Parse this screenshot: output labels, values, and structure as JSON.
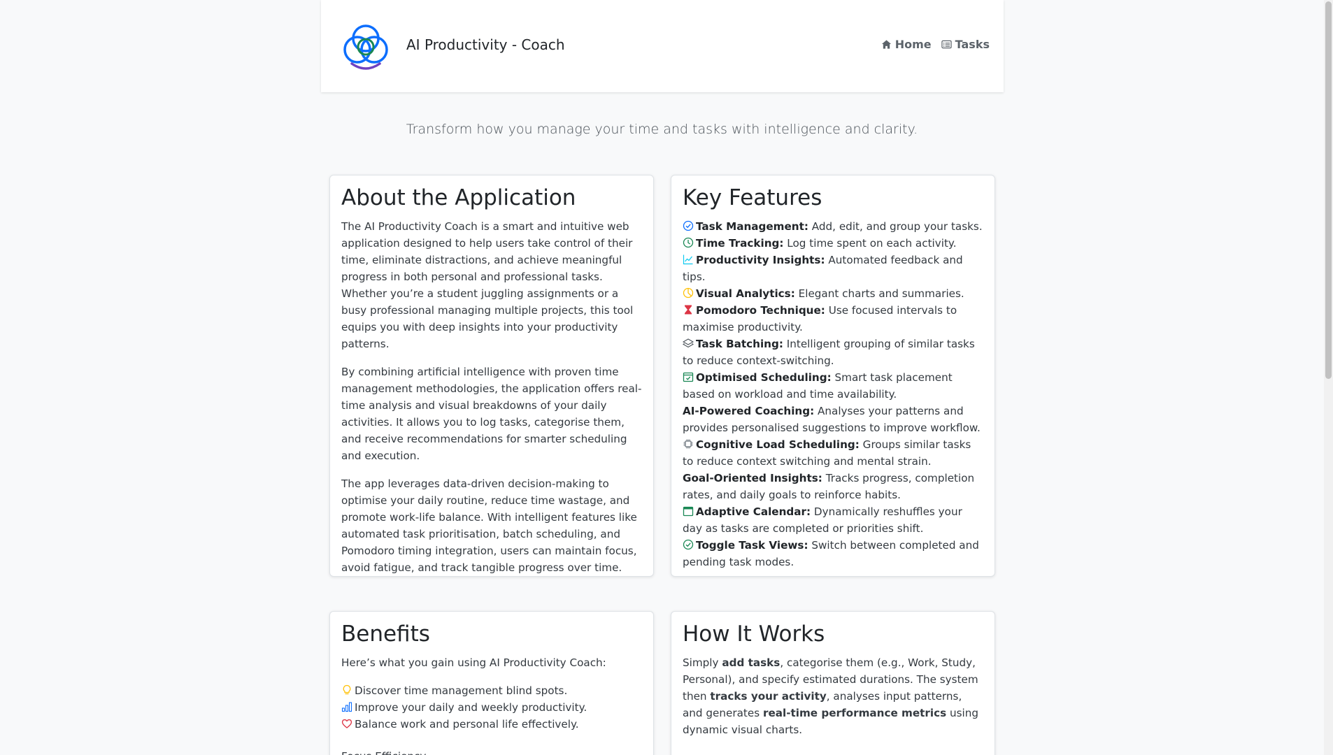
{
  "nav": {
    "brand_title": "AI Productivity - Coach",
    "links": [
      {
        "label": "Home",
        "icon": "home-icon"
      },
      {
        "label": "Tasks",
        "icon": "card-list-icon"
      }
    ]
  },
  "tagline": "Transform how you manage your time and tasks with intelligence and clarity.",
  "about": {
    "title": "About the Application",
    "paragraphs": [
      "The AI Productivity Coach is a smart and intuitive web application designed to help users take control of their time, eliminate distractions, and achieve meaningful progress in both personal and professional tasks. Whether you’re a student juggling assignments or a busy professional managing multiple projects, this tool equips you with deep insights into your productivity patterns.",
      "By combining artificial intelligence with proven time management methodologies, the application offers real-time analysis and visual breakdowns of your daily activities. It allows you to log tasks, categorise them, and receive recommendations for smarter scheduling and execution.",
      "The app leverages data-driven decision-making to optimise your daily routine, reduce time wastage, and promote work-life balance. With intelligent features like automated task prioritisation, batch scheduling, and Pomodoro timing integration, users can maintain focus, avoid fatigue, and track tangible progress over time."
    ]
  },
  "features": {
    "title": "Key Features",
    "items": [
      {
        "icon": "check-circle-icon",
        "name": "Task Management:",
        "desc": " Add, edit, and group your tasks."
      },
      {
        "icon": "clock-icon",
        "name": "Time Tracking:",
        "desc": " Log time spent on each activity."
      },
      {
        "icon": "graph-up-icon",
        "name": "Productivity Insights:",
        "desc": " Automated feedback and tips."
      },
      {
        "icon": "pie-chart-icon",
        "name": "Visual Analytics:",
        "desc": " Elegant charts and summaries."
      },
      {
        "icon": "hourglass-icon",
        "name": "Pomodoro Technique:",
        "desc": " Use focused intervals to maximise productivity."
      },
      {
        "icon": "layers-icon",
        "name": "Task Batching:",
        "desc": " Intelligent grouping of similar tasks to reduce context-switching."
      },
      {
        "icon": "calendar-check-icon",
        "name": "Optimised Scheduling:",
        "desc": " Smart task placement based on workload and time availability."
      },
      {
        "icon": "",
        "name": "AI-Powered Coaching:",
        "desc": " Analyses your patterns and provides personalised suggestions to improve workflow."
      },
      {
        "icon": "cpu-icon",
        "name": "Cognitive Load Scheduling:",
        "desc": " Groups similar tasks to reduce context switching and mental strain."
      },
      {
        "icon": "",
        "name": "Goal-Oriented Insights:",
        "desc": " Tracks progress, completion rates, and daily goals to reinforce habits."
      },
      {
        "icon": "calendar-icon",
        "name": "Adaptive Calendar:",
        "desc": " Dynamically reshuffles your day as tasks are completed or priorities shift."
      },
      {
        "icon": "check-circle-icon",
        "name": "Toggle Task Views:",
        "desc": " Switch between completed and pending task modes."
      }
    ]
  },
  "benefits": {
    "title": "Benefits",
    "intro": "Here’s what you gain using AI Productivity Coach:",
    "items": [
      {
        "icon": "lightbulb-icon",
        "text": "Discover time management blind spots."
      },
      {
        "icon": "bar-chart-icon",
        "text": "Improve your daily and weekly productivity."
      },
      {
        "icon": "heart-icon",
        "text": "Balance work and personal life effectively."
      }
    ],
    "next_heading": "Focus Efficiency"
  },
  "how": {
    "title": "How It Works",
    "parts": [
      {
        "text": "Simply ",
        "bold": false
      },
      {
        "text": "add tasks",
        "bold": true
      },
      {
        "text": ", categorise them (e.g., Work, Study, Personal), and specify estimated durations. The system then ",
        "bold": false
      },
      {
        "text": "tracks your activity",
        "bold": true
      },
      {
        "text": ", analyses input patterns, and generates ",
        "bold": false
      },
      {
        "text": "real-time performance metrics",
        "bold": true
      },
      {
        "text": " using dynamic visual charts.",
        "bold": false
      }
    ]
  },
  "colors": {
    "accent_blue": "#0d6efd",
    "accent_green": "#198754",
    "accent_yellow": "#ffc107",
    "accent_red": "#dc3545",
    "logo_purple": "#6f42c1"
  }
}
